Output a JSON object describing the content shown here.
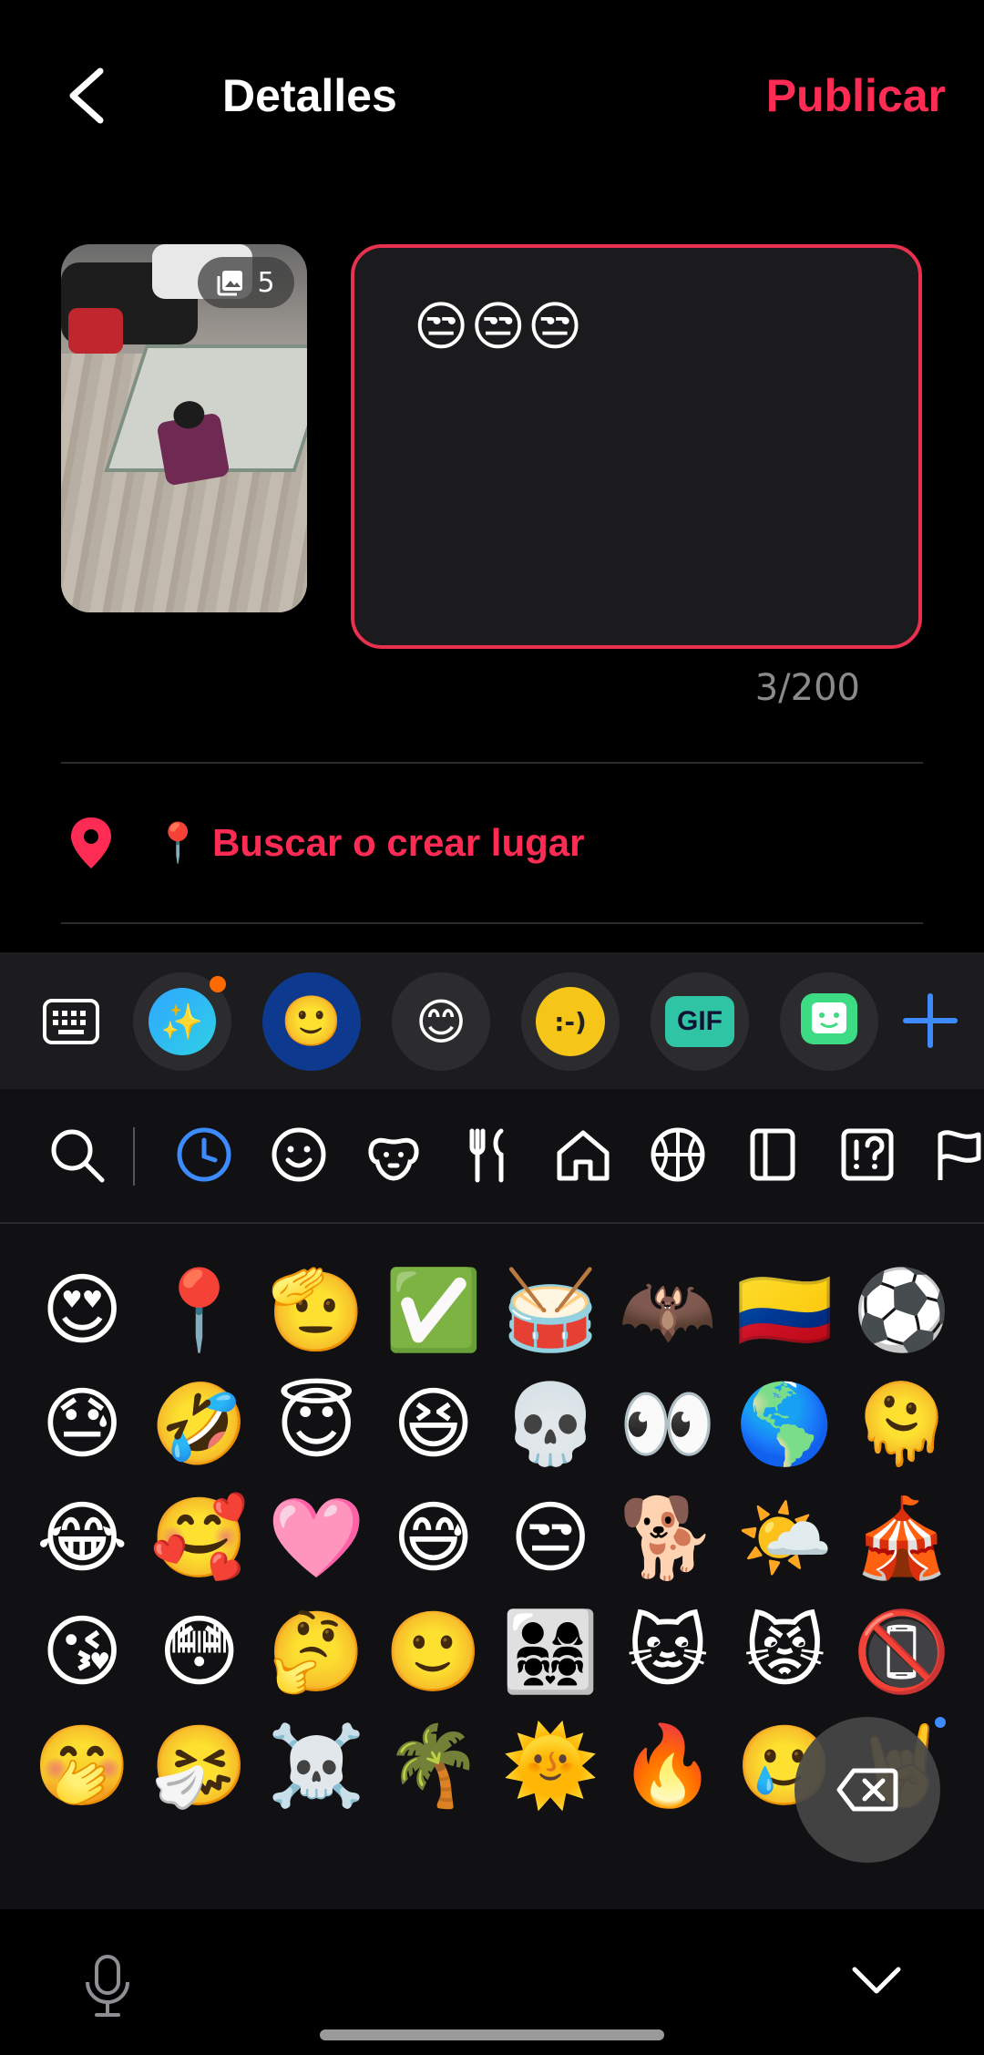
{
  "header": {
    "title": "Detalles",
    "publish_label": "Publicar"
  },
  "post": {
    "photo_count": "5",
    "caption": "😒😒😒",
    "char_counter": "3/200"
  },
  "location": {
    "label": "📍 Buscar o crear lugar"
  },
  "keyboard_toolbar": {
    "tools": [
      {
        "name": "ai-sparkle",
        "glyph": "✨"
      },
      {
        "name": "emoji",
        "glyph": "🙂"
      },
      {
        "name": "emoji-stickers",
        "glyph": "😊"
      },
      {
        "name": "text-emoticon",
        "glyph": ":-)"
      },
      {
        "name": "gif",
        "glyph": "GIF"
      },
      {
        "name": "sticker",
        "glyph": "🙂"
      }
    ]
  },
  "emoji_categories": [
    "search",
    "recent",
    "smileys",
    "animals",
    "food",
    "places",
    "activities",
    "objects",
    "symbols",
    "flags"
  ],
  "emoji_grid": [
    "😍",
    "📍",
    "🫡",
    "✅",
    "🥁",
    "🦇",
    "🇨🇴",
    "⚽",
    "😓",
    "🤣",
    "😇",
    "😆",
    "💀",
    "👀",
    "🌎",
    "🫠",
    "😂",
    "🥰",
    "🩷",
    "😅",
    "😒",
    "🐕",
    "🌤️",
    "🎪",
    "😘",
    "😳",
    "🤔",
    "🙂",
    "👨‍👩‍👧‍👧",
    "🐱",
    "😾",
    "📵",
    "🤭",
    "🤧",
    "☠️",
    "🌴",
    "🌞",
    "🔥",
    "🥲",
    "🤘"
  ],
  "colors": {
    "accent": "#fe2c55",
    "active_tab": "#3d8bff"
  }
}
